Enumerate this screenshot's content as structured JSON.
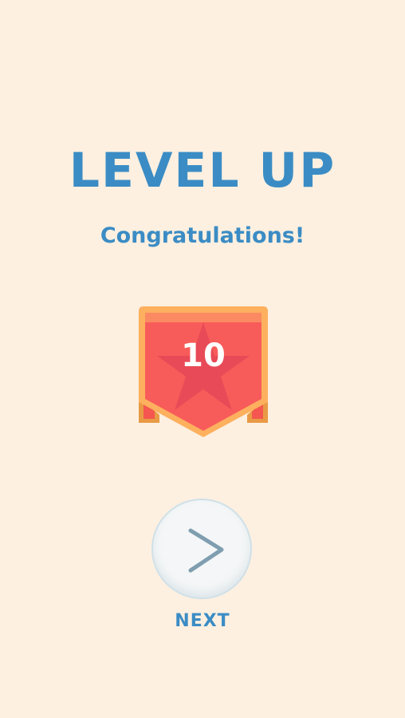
{
  "screen": {
    "title": "LEVEL UP",
    "subtitle": "Congratulations!"
  },
  "badge": {
    "level": "10",
    "icon": "star-ribbon-badge",
    "colors": {
      "banner": "#f85c5a",
      "border": "#fdb05e",
      "star": "#e84a57"
    }
  },
  "next_button": {
    "label": "NEXT",
    "icon": "chevron-right-icon"
  },
  "colors": {
    "background": "#fdf0e1",
    "text_accent": "#3b8cc4"
  }
}
